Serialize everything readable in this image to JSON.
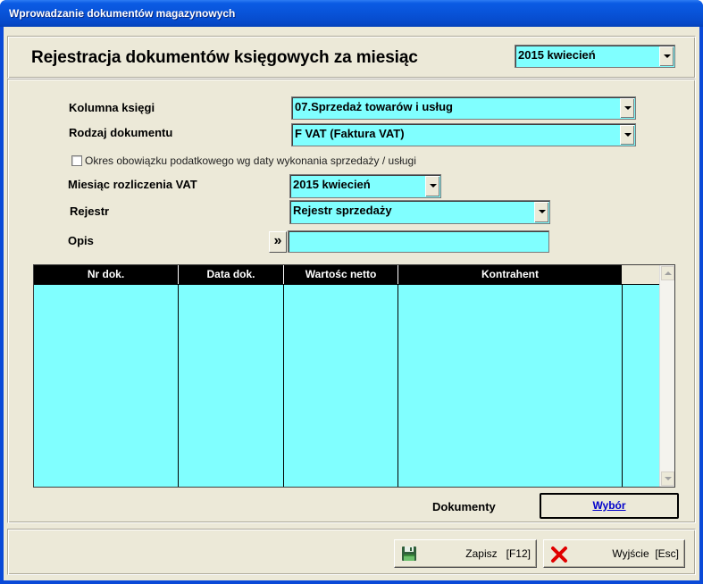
{
  "window": {
    "title": "Wprowadzanie dokumentów magazynowych"
  },
  "header": {
    "title": "Rejestracja dokumentów księgowych za miesiąc",
    "month_select": "2015 kwiecień"
  },
  "form": {
    "kolumna_label": "Kolumna księgi",
    "kolumna_value": "07.Sprzedaż towarów i usług",
    "rodzaj_label": "Rodzaj dokumentu",
    "rodzaj_value": "F VAT (Faktura VAT)",
    "checkbox_label": "Okres obowiązku podatkowego wg daty wykonania sprzedaży / usługi",
    "miesiac_label": "Miesiąc rozliczenia VAT",
    "miesiac_value": "2015 kwiecień",
    "rejestr_label": "Rejestr",
    "rejestr_value": "Rejestr sprzedaży",
    "opis_label": "Opis",
    "opis_button": "»",
    "opis_value": ""
  },
  "grid": {
    "columns": [
      "Nr dok.",
      "Data dok.",
      "Wartośc netto",
      "Kontrahent"
    ],
    "rows": []
  },
  "documents": {
    "label": "Dokumenty",
    "select_button": "Wybór"
  },
  "footer": {
    "save_button": "Zapisz   [F12]",
    "exit_button": "Wyjście  [Esc]"
  },
  "colors": {
    "field_bg": "#80ffff",
    "grid_header_bg": "#000000",
    "link_blue": "#0000cc",
    "exit_icon_red": "#e00000",
    "save_icon_green": "#3a8a3a"
  },
  "icons": {
    "save": "floppy-disk-icon",
    "exit": "red-x-icon"
  }
}
